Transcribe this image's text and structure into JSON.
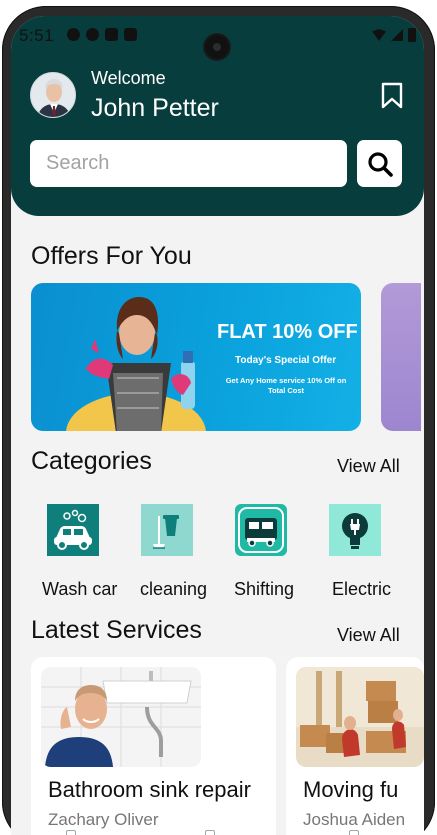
{
  "status_bar": {
    "time": "5:51"
  },
  "header": {
    "welcome_label": "Welcome",
    "user_name": "John Petter"
  },
  "search": {
    "placeholder": "Search"
  },
  "offers": {
    "title": "Offers For You",
    "banner": {
      "headline": "FLAT 10% OFF",
      "subheadline": "Today's Special Offer",
      "description": "Get Any Home service 10% Off on Total Cost"
    }
  },
  "categories": {
    "title": "Categories",
    "view_all": "View All",
    "items": [
      {
        "label": "Wash car",
        "icon": "car-wash-icon"
      },
      {
        "label": "cleaning",
        "icon": "cleaning-bucket-icon"
      },
      {
        "label": "Shifting",
        "icon": "moving-truck-icon"
      },
      {
        "label": "Electric",
        "icon": "bulb-plug-icon"
      }
    ]
  },
  "services": {
    "title": "Latest Services",
    "view_all": "View All",
    "items": [
      {
        "title": "Bathroom sink repair",
        "provider": "Zachary Oliver"
      },
      {
        "title": "Moving fu",
        "provider": "Joshua Aiden"
      }
    ]
  },
  "colors": {
    "header_bg": "#083d3d",
    "offer_blue": "#0aa1dc",
    "category_teal": "#0e7f7a",
    "category_mint": "#8fd8cf"
  }
}
